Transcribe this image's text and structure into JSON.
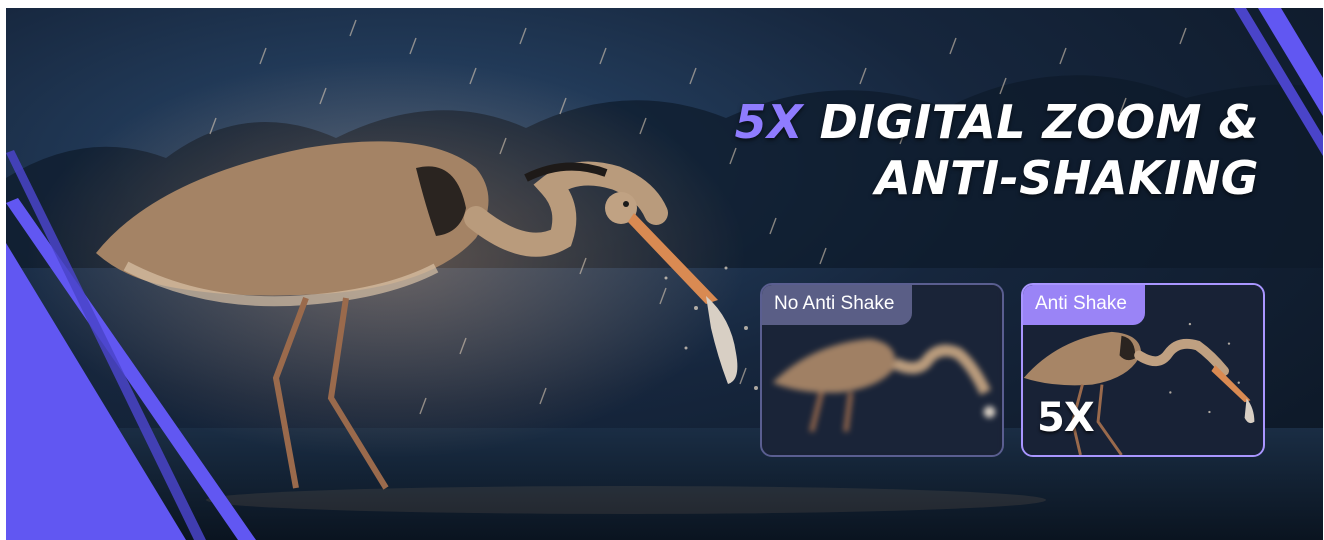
{
  "headline": {
    "accent": "5X",
    "line1_rest": " DIGITAL ZOOM &",
    "line2": "ANTI-SHAKING"
  },
  "comparison": {
    "no_anti_shake_label": "No Anti Shake",
    "anti_shake_label": "Anti Shake",
    "zoom_badge": "5X"
  },
  "colors": {
    "accent_purple": "#8f7cff",
    "stripe_purple": "#6157f2",
    "background_dark": "#0b1522"
  },
  "icons": [
    "heron-photo",
    "diagonal-stripe-decoration"
  ]
}
